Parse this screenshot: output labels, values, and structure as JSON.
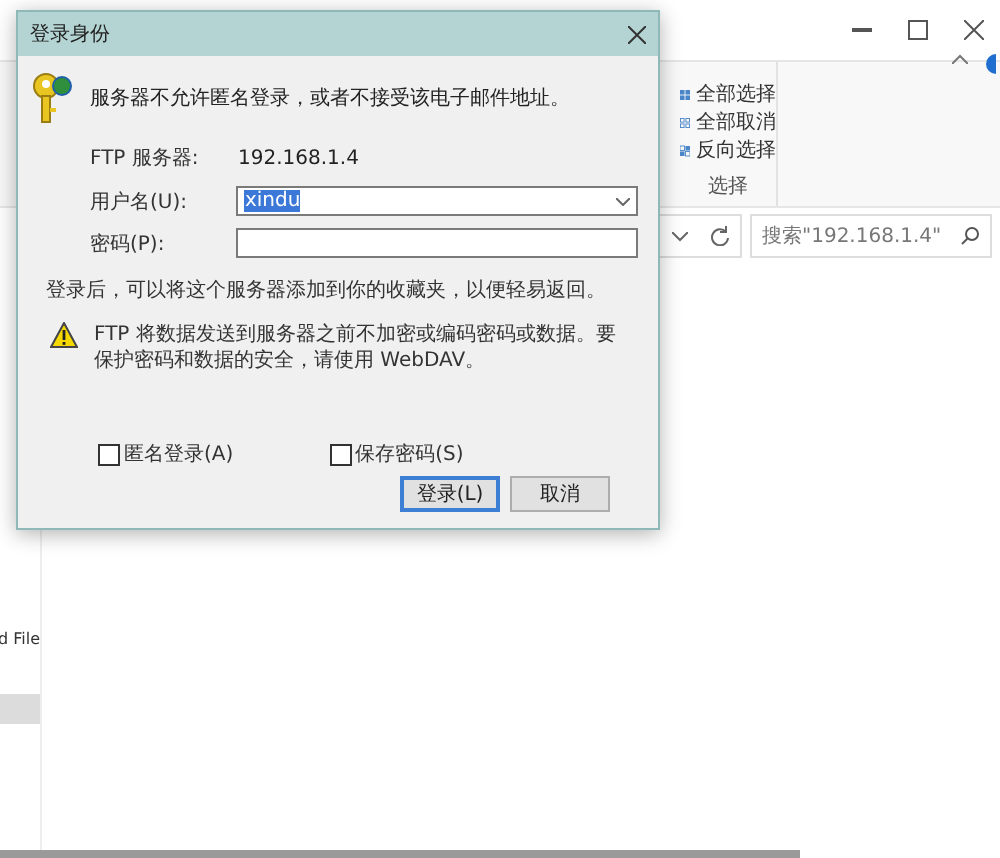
{
  "dialog": {
    "title": "登录身份",
    "message": "服务器不允许匿名登录，或者不接受该电子邮件地址。",
    "ftp_server_label": "FTP 服务器:",
    "ftp_server": "192.168.1.4",
    "username_label": "用户名(U):",
    "username": "xindu",
    "username_text_selected": true,
    "password_label": "密码(P):",
    "info": "登录后，可以将这个服务器添加到你的收藏夹，以便轻易返回。",
    "warning": "FTP 将数据发送到服务器之前不加密或编码密码或数据。要保护密码和数据的安全，请使用 WebDAV。",
    "checkboxes": [
      {
        "label": "匿名登录(A)",
        "checked": false
      },
      {
        "label": "保存密码(S)",
        "checked": false
      }
    ],
    "buttons": [
      {
        "label": "登录(L)",
        "default": true
      },
      {
        "label": "取消",
        "default": false
      }
    ]
  },
  "explorer": {
    "ribbon_group": {
      "label": "选择",
      "items": [
        "全部选择",
        "全部取消",
        "反向选择"
      ]
    },
    "search": {
      "placeholder": "搜索\"192.168.1.4\""
    },
    "nav_items": [
      {
        "label": "d File",
        "selected": false
      },
      {
        "selected": true
      }
    ]
  }
}
